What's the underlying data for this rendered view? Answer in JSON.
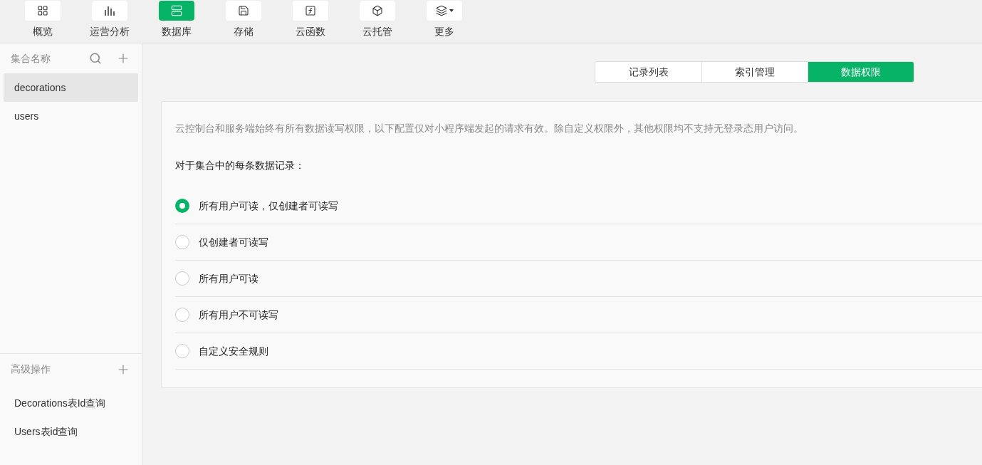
{
  "toolbar": [
    {
      "label": "概览",
      "selected": false
    },
    {
      "label": "运营分析",
      "selected": false
    },
    {
      "label": "数据库",
      "selected": true
    },
    {
      "label": "存储",
      "selected": false
    },
    {
      "label": "云函数",
      "selected": false
    },
    {
      "label": "云托管",
      "selected": false
    },
    {
      "label": "更多",
      "selected": false,
      "has_menu": true
    }
  ],
  "sidebar": {
    "title": "集合名称",
    "collections": [
      {
        "label": "decorations",
        "selected": true
      },
      {
        "label": "users",
        "selected": false
      }
    ],
    "advanced_title": "高级操作",
    "advanced_items": [
      "Decorations表Id查询",
      "Users表id查询"
    ]
  },
  "tabs": [
    {
      "label": "记录列表",
      "selected": false
    },
    {
      "label": "索引管理",
      "selected": false
    },
    {
      "label": "数据权限",
      "selected": true
    }
  ],
  "permissions": {
    "notice": "云控制台和服务端始终有所有数据读写权限，以下配置仅对小程序端发起的请求有效。除自定义权限外，其他权限均不支持无登录态用户访问。",
    "prompt": "对于集合中的每条数据记录：",
    "options": [
      {
        "label": "所有用户可读，仅创建者可读写",
        "selected": true
      },
      {
        "label": "仅创建者可读写",
        "selected": false
      },
      {
        "label": "所有用户可读",
        "selected": false
      },
      {
        "label": "所有用户不可读写",
        "selected": false
      },
      {
        "label": "自定义安全规则",
        "selected": false
      }
    ]
  }
}
